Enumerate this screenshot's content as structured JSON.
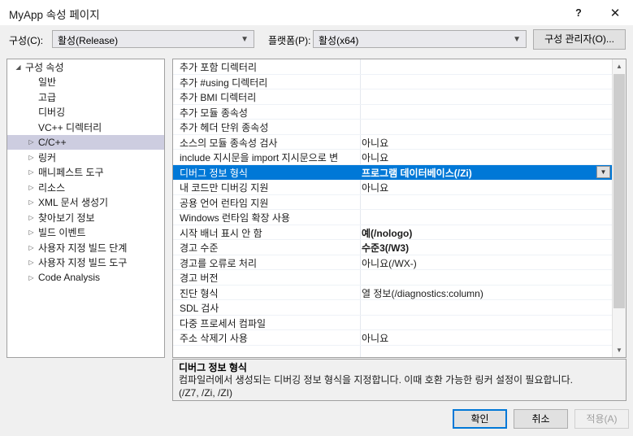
{
  "window": {
    "title": "MyApp 속성 페이지",
    "help_icon": "question-mark-icon",
    "close_icon": "close-icon"
  },
  "config_bar": {
    "configuration_label": "구성(C):",
    "configuration_value": "활성(Release)",
    "platform_label": "플랫폼(P):",
    "platform_value": "활성(x64)",
    "config_manager_button": "구성 관리자(O)...",
    "chevron_icon": "chevron-down-icon"
  },
  "tree": {
    "items": [
      {
        "label": "구성 속성",
        "depth": 0,
        "arrow": "expanded",
        "selected": false
      },
      {
        "label": "일반",
        "depth": 1,
        "arrow": "none",
        "selected": false
      },
      {
        "label": "고급",
        "depth": 1,
        "arrow": "none",
        "selected": false
      },
      {
        "label": "디버깅",
        "depth": 1,
        "arrow": "none",
        "selected": false
      },
      {
        "label": "VC++ 디렉터리",
        "depth": 1,
        "arrow": "none",
        "selected": false
      },
      {
        "label": "C/C++",
        "depth": 1,
        "arrow": "collapsed",
        "selected": true
      },
      {
        "label": "링커",
        "depth": 1,
        "arrow": "collapsed",
        "selected": false
      },
      {
        "label": "매니페스트 도구",
        "depth": 1,
        "arrow": "collapsed",
        "selected": false
      },
      {
        "label": "리소스",
        "depth": 1,
        "arrow": "collapsed",
        "selected": false
      },
      {
        "label": "XML 문서 생성기",
        "depth": 1,
        "arrow": "collapsed",
        "selected": false
      },
      {
        "label": "찾아보기 정보",
        "depth": 1,
        "arrow": "collapsed",
        "selected": false
      },
      {
        "label": "빌드 이벤트",
        "depth": 1,
        "arrow": "collapsed",
        "selected": false
      },
      {
        "label": "사용자 지정 빌드 단계",
        "depth": 1,
        "arrow": "collapsed",
        "selected": false
      },
      {
        "label": "사용자 지정 빌드 도구",
        "depth": 1,
        "arrow": "collapsed",
        "selected": false
      },
      {
        "label": "Code Analysis",
        "depth": 1,
        "arrow": "collapsed",
        "selected": false
      }
    ]
  },
  "property_grid": {
    "rows": [
      {
        "name": "추가 포함 디렉터리",
        "value": "",
        "bold": false,
        "selected": false,
        "editor": false
      },
      {
        "name": "추가 #using 디렉터리",
        "value": "",
        "bold": false,
        "selected": false,
        "editor": false
      },
      {
        "name": "추가 BMI 디렉터리",
        "value": "",
        "bold": false,
        "selected": false,
        "editor": false
      },
      {
        "name": "추가 모듈 종속성",
        "value": "",
        "bold": false,
        "selected": false,
        "editor": false
      },
      {
        "name": "추가 헤더 단위 종속성",
        "value": "",
        "bold": false,
        "selected": false,
        "editor": false
      },
      {
        "name": "소스의 모듈 종속성 검사",
        "value": "아니요",
        "bold": false,
        "selected": false,
        "editor": false
      },
      {
        "name": "include 지시문을 import 지시문으로 변",
        "value": "아니요",
        "bold": false,
        "selected": false,
        "editor": false
      },
      {
        "name": "디버그 정보 형식",
        "value": "프로그램 데이터베이스(/Zi)",
        "bold": true,
        "selected": true,
        "editor": true
      },
      {
        "name": "내 코드만 디버깅 지원",
        "value": "아니요",
        "bold": false,
        "selected": false,
        "editor": false
      },
      {
        "name": "공용 언어 런타임 지원",
        "value": "",
        "bold": false,
        "selected": false,
        "editor": false
      },
      {
        "name": "Windows 런타임 확장 사용",
        "value": "",
        "bold": false,
        "selected": false,
        "editor": false
      },
      {
        "name": "시작 배너 표시 안 함",
        "value": "예(/nologo)",
        "bold": true,
        "selected": false,
        "editor": false
      },
      {
        "name": "경고 수준",
        "value": "수준3(/W3)",
        "bold": true,
        "selected": false,
        "editor": false
      },
      {
        "name": "경고를 오류로 처리",
        "value": "아니요(/WX-)",
        "bold": false,
        "selected": false,
        "editor": false
      },
      {
        "name": "경고 버전",
        "value": "",
        "bold": false,
        "selected": false,
        "editor": false
      },
      {
        "name": "진단 형식",
        "value": "열 정보(/diagnostics:column)",
        "bold": false,
        "selected": false,
        "editor": false
      },
      {
        "name": "SDL 검사",
        "value": "",
        "bold": false,
        "selected": false,
        "editor": false
      },
      {
        "name": "다중 프로세서 컴파일",
        "value": "",
        "bold": false,
        "selected": false,
        "editor": false
      },
      {
        "name": "주소 삭제기 사용",
        "value": "아니요",
        "bold": false,
        "selected": false,
        "editor": false
      }
    ],
    "scroll": {
      "up_arrow_icon": "chevron-up-icon",
      "down_arrow_icon": "chevron-down-icon"
    }
  },
  "description": {
    "title": "디버그 정보 형식",
    "line1": "컴파일러에서 생성되는 디버깅 정보 형식을 지정합니다. 이때 호환 가능한 링커 설정이 필요합니다.",
    "line2": "(/Z7, /Zi, /ZI)"
  },
  "buttons": {
    "ok": "확인",
    "cancel": "취소",
    "apply": "적용(A)"
  },
  "colors": {
    "accent": "#0078d7",
    "tree_selection": "#cdcde0",
    "dialog_bg": "#f0f0f0"
  }
}
